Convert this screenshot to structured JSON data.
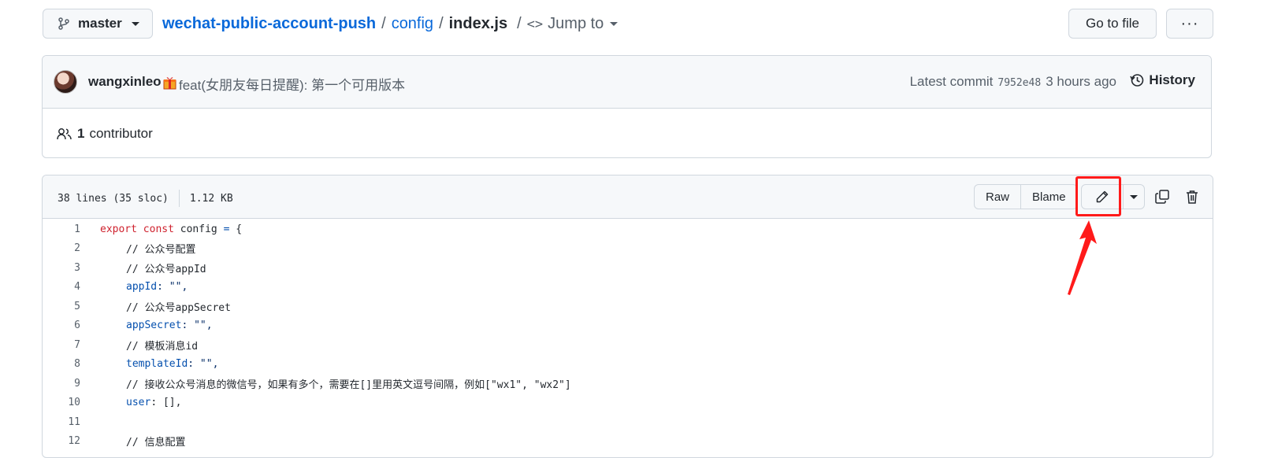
{
  "breadcrumb": {
    "branch": "master",
    "repo": "wechat-public-account-push",
    "sep": "/",
    "folder": "config",
    "file": "index.js",
    "jump_to": "Jump to"
  },
  "toolbar": {
    "goto_file": "Go to file",
    "more": "···"
  },
  "commit": {
    "author": "wangxinleo",
    "message": "feat(女朋友每日提醒): 第一个可用版本",
    "latest_label": "Latest commit",
    "sha": "7952e48",
    "time": "3 hours ago",
    "history": "History",
    "contributors_count": "1",
    "contributors_label": "contributor"
  },
  "file": {
    "lines_info": "38 lines (35 sloc)",
    "size": "1.12 KB",
    "raw": "Raw",
    "blame": "Blame"
  },
  "code": {
    "line_numbers": [
      "1",
      "2",
      "3",
      "4",
      "5",
      "6",
      "7",
      "8",
      "9",
      "10",
      "11",
      "12"
    ],
    "l1_export": "export",
    "l1_const": "const",
    "l1_name": " config ",
    "l1_eq": "=",
    "l1_brace": " {",
    "l2": "// 公众号配置",
    "l3": "// 公众号appId",
    "l4_key": "appId",
    "l4_rest": ": \"\",",
    "l5": "// 公众号appSecret",
    "l6_key": "appSecret",
    "l6_rest": ": \"\",",
    "l7": "// 模板消息id",
    "l8_key": "templateId",
    "l8_rest": ": \"\",",
    "l9": "// 接收公众号消息的微信号，如果有多个，需要在[]里用英文逗号间隔，例如[\"wx1\", \"wx2\"]",
    "l10_key": "user",
    "l10_rest": ": [],",
    "l11": "",
    "l12": "// 信息配置"
  },
  "annotation": {
    "highlight_color": "#ff1a1a"
  }
}
